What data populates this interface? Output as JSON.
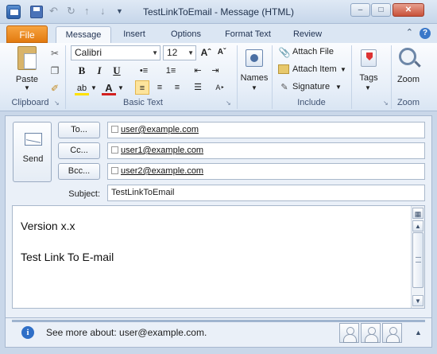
{
  "window": {
    "title": "TestLinkToEmail  -  Message (HTML)",
    "minimize": "–",
    "maximize": "□",
    "close": "✕"
  },
  "qat": {
    "undo": "↶",
    "redo": "↻",
    "up": "↑",
    "down": "↓",
    "customize": "▼"
  },
  "tabs": {
    "file": "File",
    "items": [
      "Message",
      "Insert",
      "Options",
      "Format Text",
      "Review"
    ],
    "active": "Message"
  },
  "ribbon": {
    "clipboard": {
      "label": "Clipboard",
      "paste": "Paste"
    },
    "basic_text": {
      "label": "Basic Text",
      "font": "Calibri",
      "size": "12",
      "bold": "B",
      "italic": "I",
      "underline": "U"
    },
    "names": {
      "label": "Names"
    },
    "include": {
      "label": "Include",
      "attach_file": "Attach File",
      "attach_item": "Attach Item",
      "signature": "Signature"
    },
    "tags": {
      "label": "Tags"
    },
    "zoom": {
      "label": "Zoom",
      "button": "Zoom"
    }
  },
  "compose": {
    "send": "Send",
    "to_button": "To...",
    "cc_button": "Cc...",
    "bcc_button": "Bcc...",
    "to": "user@example.com",
    "cc": "user1@example.com",
    "bcc": "user2@example.com",
    "subject_label": "Subject:",
    "subject": "TestLinkToEmail",
    "body": [
      "Version x.x",
      "Test Link To E-mail"
    ]
  },
  "people_pane": {
    "text": "See more about: user@example.com."
  },
  "colors": {
    "file_tab": "#e27a10",
    "ribbon_bg": "#e6eef8",
    "highlight": "#fde49c"
  }
}
